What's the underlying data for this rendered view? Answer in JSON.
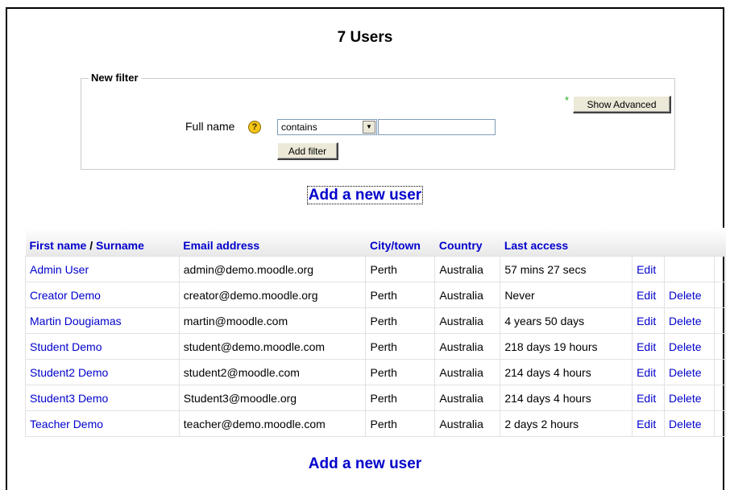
{
  "page_title": "7 Users",
  "filter": {
    "legend": "New filter",
    "required_mark": "*",
    "show_advanced_label": "Show Advanced",
    "fullname_label": "Full name",
    "help_icon_glyph": "?",
    "operator_selected": "contains",
    "text_value": "",
    "add_filter_label": "Add filter"
  },
  "add_user_label": "Add a new user",
  "table": {
    "headers": {
      "firstname": "First name",
      "separator": "/",
      "surname": "Surname",
      "email": "Email address",
      "city": "City/town",
      "country": "Country",
      "lastaccess": "Last access"
    },
    "rows": [
      {
        "name": "Admin User",
        "email": "admin@demo.moodle.org",
        "city": "Perth",
        "country": "Australia",
        "lastaccess": "57 mins 27 secs",
        "edit": "Edit",
        "delete": ""
      },
      {
        "name": "Creator Demo",
        "email": "creator@demo.moodle.org",
        "city": "Perth",
        "country": "Australia",
        "lastaccess": "Never",
        "edit": "Edit",
        "delete": "Delete"
      },
      {
        "name": "Martin Dougiamas",
        "email": "martin@moodle.com",
        "city": "Perth",
        "country": "Australia",
        "lastaccess": "4 years 50 days",
        "edit": "Edit",
        "delete": "Delete"
      },
      {
        "name": "Student Demo",
        "email": "student@demo.moodle.com",
        "city": "Perth",
        "country": "Australia",
        "lastaccess": "218 days 19 hours",
        "edit": "Edit",
        "delete": "Delete"
      },
      {
        "name": "Student2 Demo",
        "email": "student2@moodle.com",
        "city": "Perth",
        "country": "Australia",
        "lastaccess": "214 days 4 hours",
        "edit": "Edit",
        "delete": "Delete"
      },
      {
        "name": "Student3 Demo",
        "email": "Student3@moodle.org",
        "city": "Perth",
        "country": "Australia",
        "lastaccess": "214 days 4 hours",
        "edit": "Edit",
        "delete": "Delete"
      },
      {
        "name": "Teacher Demo",
        "email": "teacher@demo.moodle.com",
        "city": "Perth",
        "country": "Australia",
        "lastaccess": "2 days 2 hours",
        "edit": "Edit",
        "delete": "Delete"
      }
    ]
  },
  "colors": {
    "link": "#0000cc",
    "button_face": "#ece9d8",
    "required_star": "#22aa22",
    "help_icon": "#f5c518"
  }
}
